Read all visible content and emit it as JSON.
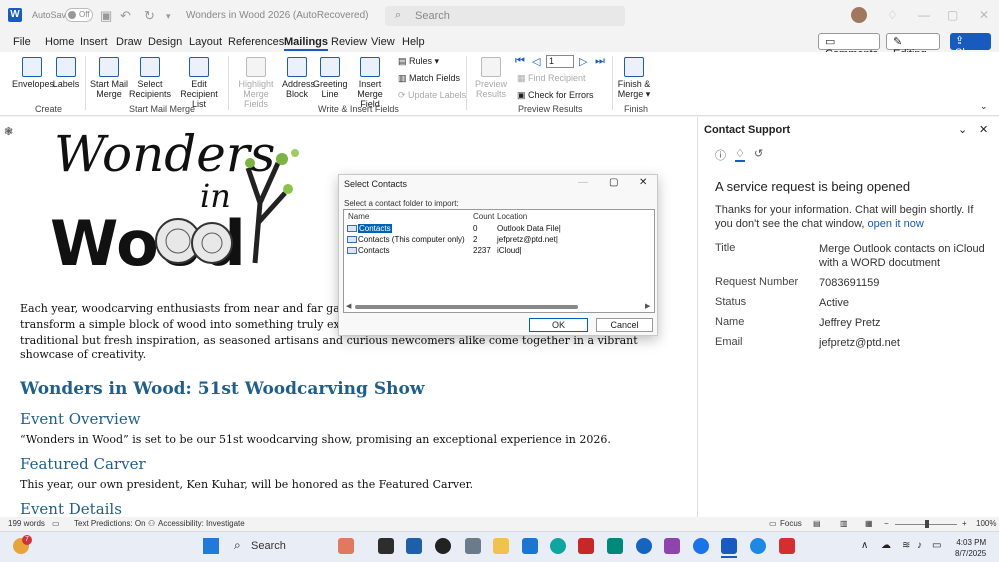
{
  "titlebar": {
    "autosave_label": "AutoSave",
    "autosave_state": "Off",
    "document_title": "Wonders in Wood 2026 (AutoRecovered)",
    "search_placeholder": "Search"
  },
  "menu": {
    "items": [
      "File",
      "Home",
      "Insert",
      "Draw",
      "Design",
      "Layout",
      "References",
      "Mailings",
      "Review",
      "View",
      "Help"
    ],
    "active": "Mailings",
    "comments_label": "Comments",
    "editing_label": "Editing",
    "share_label": "Share"
  },
  "ribbon": {
    "create": {
      "label": "Create",
      "envelopes": "Envelopes",
      "labels": "Labels"
    },
    "start_mail_merge": {
      "label": "Start Mail Merge",
      "start": "Start Mail\nMerge",
      "select": "Select\nRecipients",
      "edit": "Edit\nRecipient List"
    },
    "write_insert": {
      "label": "Write & Insert Fields",
      "highlight": "Highlight\nMerge Fields",
      "address": "Address\nBlock",
      "greeting": "Greeting\nLine",
      "insert_field": "Insert Merge\nField",
      "rules": "Rules",
      "match": "Match Fields",
      "update": "Update Labels"
    },
    "preview": {
      "label": "Preview Results",
      "preview": "Preview\nResults",
      "record": "1",
      "find": "Find Recipient",
      "check": "Check for Errors"
    },
    "finish": {
      "label": "Finish",
      "finish_merge": "Finish &\nMerge"
    }
  },
  "document": {
    "logo_line1": "Wonders",
    "logo_line2": "in",
    "logo_line3": "Wood",
    "para1_l1": "Each year, woodcarving enthusiasts from near and far gathe",
    "para1_l2": "transform a simple block of wood into something truly extra",
    "para1_l3": "traditional but fresh inspiration, as seasoned artisans and curious newcomers alike come together in a vibrant",
    "para1_l4": "showcase of creativity.",
    "heading1": "Wonders in Wood: 51st Woodcarving Show",
    "h_overview": "Event Overview",
    "overview_text": "“Wonders in Wood” is set to be our 51st woodcarving show, promising an exceptional experience in 2026.",
    "h_carver": "Featured Carver",
    "carver_text": "This year, our own president, Ken Kuhar, will be honored as the Featured Carver.",
    "h_details": "Event Details"
  },
  "dialog": {
    "title": "Select Contacts",
    "prompt": "Select a contact folder to import:",
    "columns": [
      "Name",
      "Count",
      "Location"
    ],
    "rows": [
      {
        "name": "Contacts",
        "count": "0",
        "location": "Outlook Data File|"
      },
      {
        "name": "Contacts (This computer only)",
        "count": "2",
        "location": "jefpretz@ptd.net|"
      },
      {
        "name": "Contacts",
        "count": "2237",
        "location": "iCloud|"
      }
    ],
    "ok": "OK",
    "cancel": "Cancel"
  },
  "pane": {
    "title": "Contact Support",
    "heading": "A service request is being opened",
    "message": "Thanks for your information. Chat will begin shortly. If you don't see the chat window, ",
    "link": "open it now",
    "fields": [
      {
        "key": "Title",
        "value": "Merge Outlook contacts on iCloud with a WORD docutment"
      },
      {
        "key": "Request Number",
        "value": "7083691159"
      },
      {
        "key": "Status",
        "value": "Active"
      },
      {
        "key": "Name",
        "value": "Jeffrey Pretz"
      },
      {
        "key": "Email",
        "value": "jefpretz@ptd.net"
      }
    ]
  },
  "statusbar": {
    "words": "199 words",
    "predictions": "Text Predictions: On",
    "accessibility": "Accessibility: Investigate",
    "focus": "Focus",
    "zoom": "100%"
  },
  "taskbar": {
    "search": "Search",
    "notif_badge": "7",
    "time": "4:03 PM",
    "date": "8/7/2025"
  },
  "colors": {
    "accent": "#185abd",
    "heading": "#1f5f8a"
  }
}
